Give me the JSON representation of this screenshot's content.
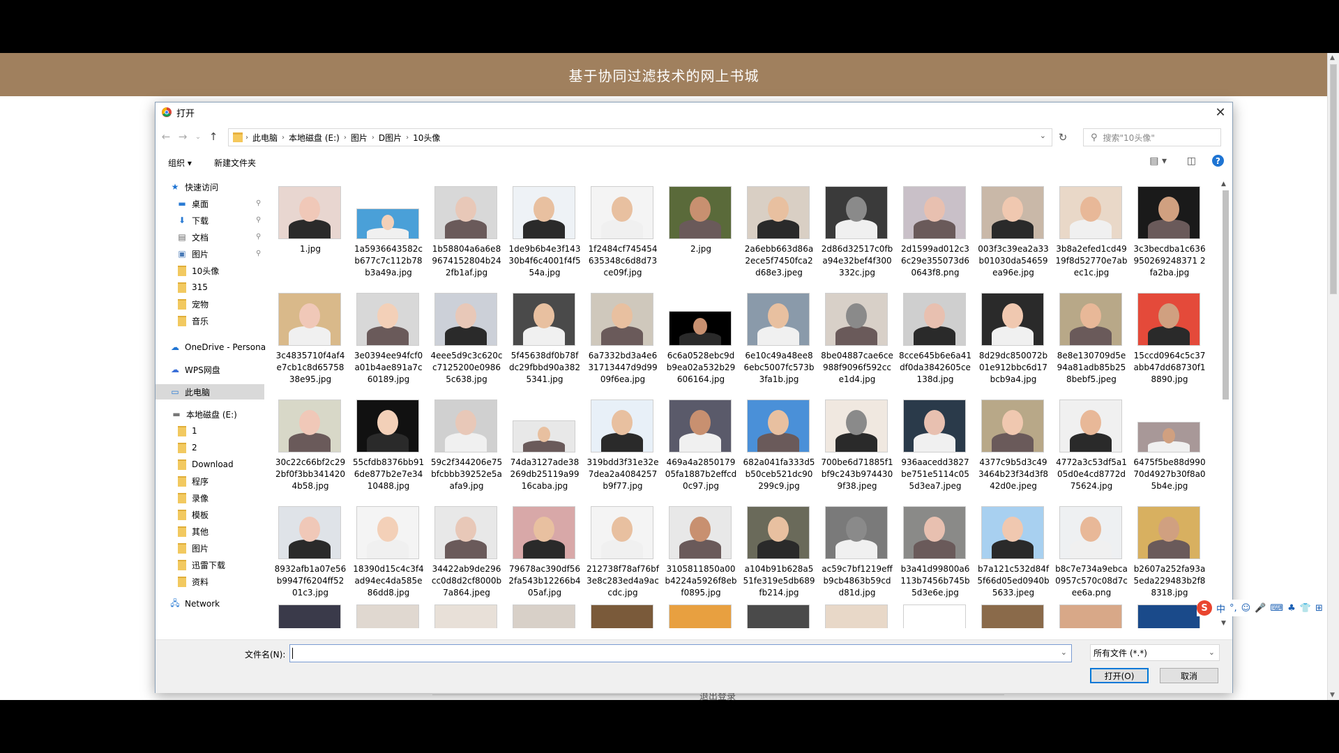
{
  "website": {
    "title": "基于协同过滤技术的网上书城",
    "bottom_link": "退出登录"
  },
  "dialog": {
    "title": "打开",
    "breadcrumb": [
      "此电脑",
      "本地磁盘 (E:)",
      "图片",
      "D图片",
      "10头像"
    ],
    "search_placeholder": "搜索\"10头像\"",
    "toolbar": {
      "organize": "组织 ▾",
      "new_folder": "新建文件夹"
    },
    "nav": {
      "quick_access": "快速访问",
      "qa_items": [
        "桌面",
        "下载",
        "文档",
        "图片",
        "10头像",
        "315",
        "宠物",
        "音乐"
      ],
      "onedrive": "OneDrive - Persona",
      "wps": "WPS网盘",
      "this_pc": "此电脑",
      "drive": "本地磁盘 (E:)",
      "drive_items": [
        "1",
        "2",
        "Download",
        "程序",
        "录像",
        "模板",
        "其他",
        "图片",
        "迅雷下载",
        "资料"
      ],
      "network": "Network"
    },
    "files": [
      [
        "1.jpg",
        "1a5936643582cb677c7c112b78b3a49a.jpg",
        "1b58804a6a6e89674152804b242fb1af.jpg",
        "1de9b6b4e3f14330b4f6c4001f4f554a.jpg",
        "1f2484cf745454635348c6d8d73ce09f.jpg",
        "2.jpg",
        "2a6ebb663d86a2ece5f7450fca2d68e3.jpeg",
        "2d86d32517c0fba94e32bef4f300332c.jpg",
        "2d1599ad012c36c29e355073d60643f8.png",
        "003f3c39ea2a33b01030da54659ea96e.jpg",
        "3b8a2efed1cd4919f8d52770e7abec1c.jpg",
        "3c3becdba1c636950269248371 2fa2ba.jpg"
      ],
      [
        "3c4835710f4af4e7cb1c8d6575838e95.jpg",
        "3e0394ee94fcf0a01b4ae891a7c60189.jpg",
        "4eee5d9c3c620cc7125200e09865c638.jpg",
        "5f45638df0b78fdc29fbbd90a3825341.jpg",
        "6a7332bd3a4e631713447d9d9909f6ea.jpg",
        "6c6a0528ebc9db9ea02a532b29606164.jpg",
        "6e10c49a48ee86ebc5007fc573b3fa1b.jpg",
        "8be04887cae6ce988f9096f592cce1d4.jpg",
        "8cce645b6e6a41df0da3842605ce138d.jpg",
        "8d29dc850072b01e912bbc6d17bcb9a4.jpg",
        "8e8e130709d5e94a81adb85b258bebf5.jpeg",
        "15ccd0964c5c37abb47dd68730f18890.jpg"
      ],
      [
        "30c22c66bf2c292bf0f3bb3414204b58.jpg",
        "55cfdb8376bb916de877b2e7e3410488.jpg",
        "59c2f344206e75bfcbbb39252e5aafa9.jpg",
        "74da3127ade38269db25119a9916caba.jpg",
        "319bdd3f31e32e7dea2a4084257b9f77.jpg",
        "469a4a2850179 05fa1887b2effcd0c97.jpg",
        "682a041fa333d5b50ceb521dc90299c9.jpg",
        "700be6d71885f1bf9c243b9744309f38.jpeg",
        "936aacedd3827be751e5114c055d3ea7.jpeg",
        "4377c9b5d3c493464b23f34d3f842d0e.jpeg",
        "4772a3c53df5a105d0e4cd8772d75624.jpg",
        "6475f5be88d99070d4927b30f8a05b4e.jpg"
      ],
      [
        "8932afb1a07e56b9947f6204ff5201c3.jpg",
        "18390d15c4c3f4ad94ec4da585e86dd8.jpg",
        "34422ab9de296cc0d8d2cf8000b7a864.jpeg",
        "79678ac390df562fa543b12266b405af.jpg",
        "212738f78af76bf3e8c283ed4a9accdc.jpg",
        "3105811850a00b4224a5926f8ebf0895.jpg",
        "a104b91b628a551fe319e5db689fb214.jpg",
        "ac59c7bf1219effb9cb4863b59cdd81d.jpg",
        "b3a41d99800a6113b7456b745b5d3e6e.jpg",
        "b7a121c532d84f5f66d05ed0940b5633.jpeg",
        "b8c7e734a9ebca0957c570c08d7cee6a.png",
        "b2607a252fa93a5eda229483b2f88318.jpg"
      ]
    ],
    "filename_label": "文件名(N):",
    "filename_value": "",
    "filter": "所有文件 (*.*)",
    "open_button": "打开(O)",
    "cancel_button": "取消"
  },
  "ime": {
    "labels": [
      "中",
      "°,",
      "☺",
      "🎤",
      "⌨",
      "♣",
      "👕",
      "⊞"
    ],
    "logo": "S"
  }
}
